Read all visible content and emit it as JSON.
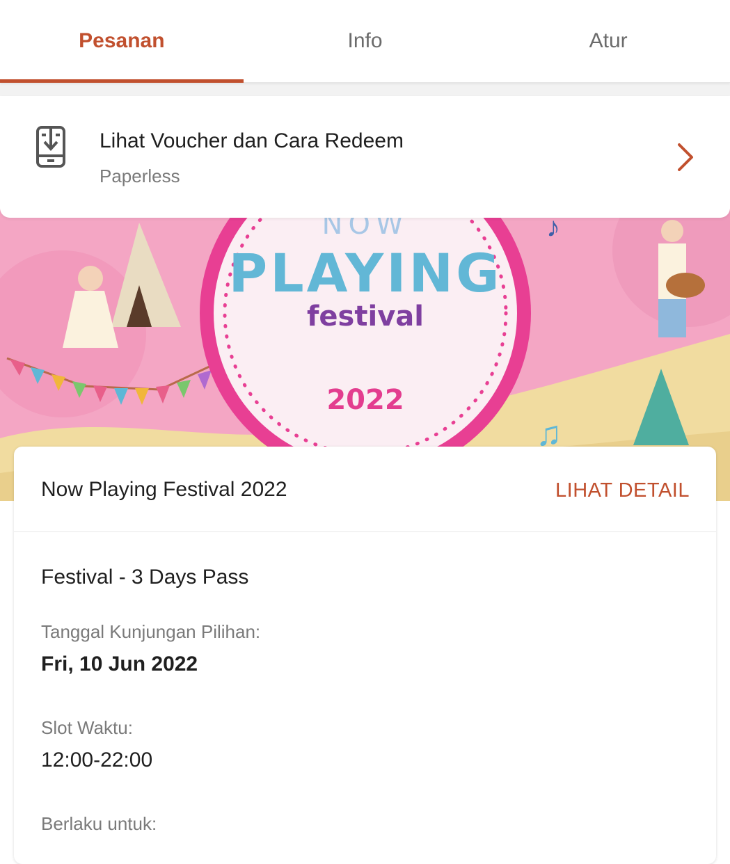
{
  "tabs": [
    {
      "label": "Pesanan",
      "active": true
    },
    {
      "label": "Info",
      "active": false
    },
    {
      "label": "Atur",
      "active": false
    }
  ],
  "voucher": {
    "icon": "phone-download-icon",
    "title": "Lihat Voucher dan Cara Redeem",
    "subtitle": "Paperless",
    "chevron": "chevron-right-icon"
  },
  "banner": {
    "line1": "NOW",
    "line2": "PLAYING",
    "line3": "festival",
    "year": "2022"
  },
  "event": {
    "name": "Now Playing Festival 2022",
    "detail_label": "LIHAT DETAIL",
    "package": "Festival - 3 Days Pass",
    "visit_label": "Tanggal Kunjungan Pilihan:",
    "visit_value": "Fri, 10 Jun 2022",
    "slot_label": "Slot Waktu:",
    "slot_value": "12:00-22:00",
    "valid_label": "Berlaku untuk:"
  },
  "colors": {
    "accent": "#c1502e",
    "banner_pink": "#f6a9c5",
    "circle_ring": "#e83f93"
  }
}
